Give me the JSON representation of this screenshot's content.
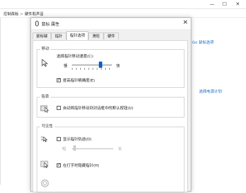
{
  "background": {
    "breadcrumb_root": "控制面板",
    "breadcrumb_sep": ">",
    "breadcrumb_current": "硬件和声音",
    "link_go": "Go 鼠标选项",
    "link_power": "选择电源计划",
    "window_controls": [
      "—",
      "☐",
      "✕"
    ]
  },
  "dialog": {
    "title": "鼠标 属性",
    "close_glyph": "✕",
    "tabs": [
      "鼠标键",
      "指针",
      "指针选项",
      "滑轮",
      "硬件"
    ],
    "active_tab": 2,
    "groups": {
      "motion": {
        "label": "移动",
        "speed_label": "选择指针移动速度(C):",
        "slow": "慢",
        "fast": "快",
        "speed_level": 0.72,
        "precision_label": "提高指针精确度(E)",
        "precision_checked": true
      },
      "snap": {
        "label": "贴靠",
        "snap_label": "自动将指针移动到对话框中的默认按钮(U)",
        "snap_checked": false
      },
      "visibility": {
        "label": "可见性",
        "trails_label": "显示指针轨迹(D)",
        "trails_checked": false,
        "short": "短",
        "long": "长",
        "hide_label": "在打字时隐藏指针(H)",
        "hide_checked": true
      }
    }
  },
  "icons": {
    "motion": "pointer-speed-icon",
    "snap": "snap-to-icon",
    "trails": "pointer-trails-icon",
    "hide": "hide-pointer-icon",
    "locate": "locate-pointer-icon"
  },
  "colors": {
    "accent": "#0a63c9",
    "link": "#1a6fc6"
  }
}
